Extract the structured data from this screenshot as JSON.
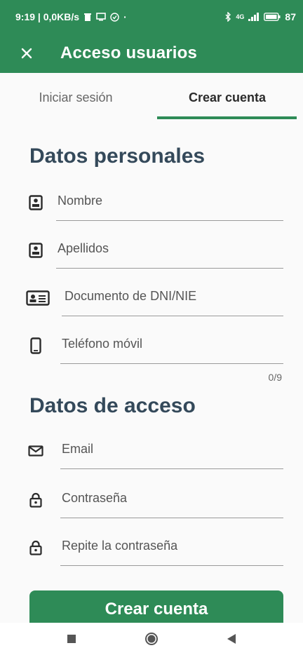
{
  "status_bar": {
    "time_speed": "9:19 | 0,0KB/s",
    "network": "4G",
    "battery": "87"
  },
  "app_bar": {
    "title": "Acceso usuarios",
    "close_icon": "close-icon"
  },
  "tabs": [
    {
      "label": "Iniciar sesión",
      "active": false
    },
    {
      "label": "Crear cuenta",
      "active": true
    }
  ],
  "personal": {
    "title": "Datos personales",
    "fields": [
      {
        "placeholder": "Nombre",
        "icon": "contact-card-icon"
      },
      {
        "placeholder": "Apellidos",
        "icon": "contact-card-icon"
      },
      {
        "placeholder": "Documento de DNI/NIE",
        "icon": "id-card-icon"
      },
      {
        "placeholder": "Teléfono móvil",
        "icon": "phone-icon"
      }
    ],
    "phone_counter": "0/9"
  },
  "access": {
    "title": "Datos de acceso",
    "fields": [
      {
        "placeholder": "Email",
        "icon": "mail-icon"
      },
      {
        "placeholder": "Contraseña",
        "icon": "lock-icon"
      },
      {
        "placeholder": "Repite la contraseña",
        "icon": "lock-icon"
      }
    ]
  },
  "submit_label": "Crear cuenta",
  "colors": {
    "primary": "#2e8b57",
    "heading": "#34495a"
  }
}
